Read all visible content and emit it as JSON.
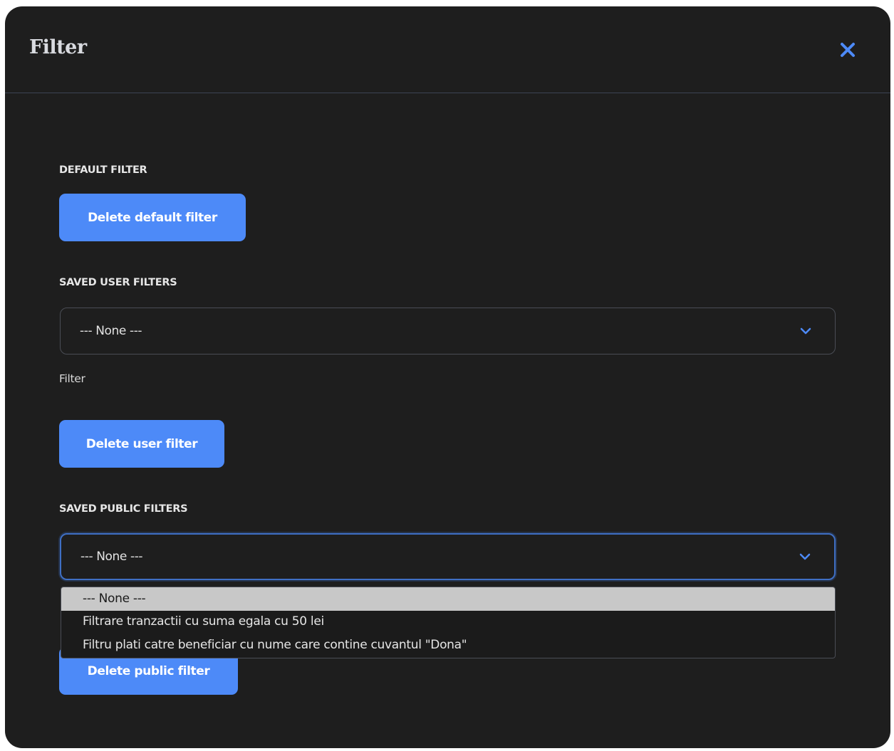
{
  "modal": {
    "title": "Filter",
    "close_icon": "close-icon",
    "accent_color": "#4d8af8"
  },
  "default_filter": {
    "heading": "DEFAULT FILTER",
    "delete_label": "Delete default filter"
  },
  "user_filters": {
    "heading": "SAVED USER FILTERS",
    "selected_value": "--- None ---",
    "field_label": "Filter",
    "delete_label": "Delete user filter"
  },
  "public_filters": {
    "heading": "SAVED PUBLIC FILTERS",
    "selected_value": "--- None ---",
    "options": [
      "--- None ---",
      "Filtrare tranzactii cu suma egala cu 50 lei",
      "Filtru plati catre beneficiar cu nume care contine cuvantul \"Dona\""
    ],
    "delete_label": "Delete public filter"
  }
}
